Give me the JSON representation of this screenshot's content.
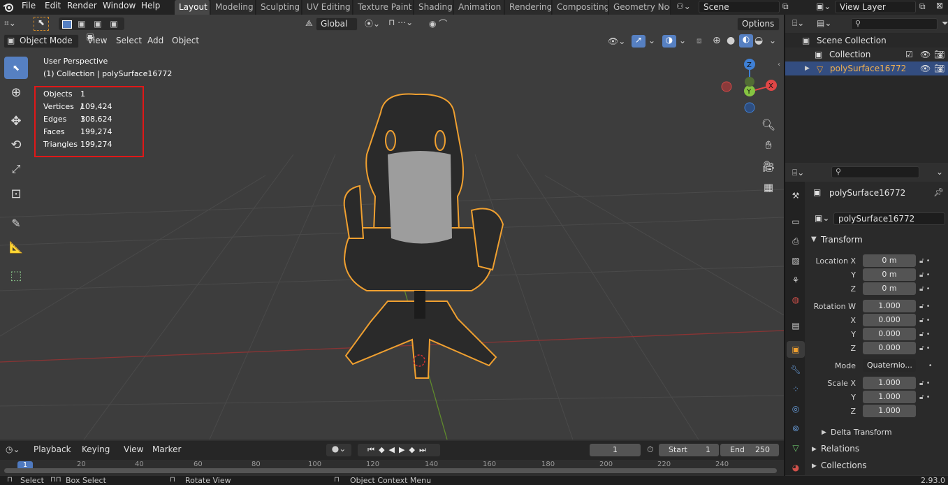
{
  "top_menu": {
    "items": [
      "File",
      "Edit",
      "Render",
      "Window",
      "Help"
    ],
    "workspaces": [
      "Layout",
      "Modeling",
      "Sculpting",
      "UV Editing",
      "Texture Paint",
      "Shading",
      "Animation",
      "Rendering",
      "Compositing",
      "Geometry Nod"
    ],
    "scene_name": "Scene",
    "view_layer_name": "View Layer"
  },
  "viewport_header": {
    "transform_orientation": "Global",
    "options_label": "Options",
    "mode_label": "Object Mode",
    "menus": [
      "View",
      "Select",
      "Add",
      "Object"
    ]
  },
  "viewport": {
    "perspective_label": "User Perspective",
    "collection_label": "(1) Collection | polySurface16772",
    "stats": [
      {
        "label": "Objects",
        "value": "1 / 1"
      },
      {
        "label": "Vertices",
        "value": "109,424"
      },
      {
        "label": "Edges",
        "value": "308,624"
      },
      {
        "label": "Faces",
        "value": "199,274"
      },
      {
        "label": "Triangles",
        "value": "199,274"
      }
    ],
    "gizmo_labels": {
      "z": "Z",
      "y": "Y",
      "x": "X"
    },
    "colors": {
      "selection_outline": "#f0a030",
      "x_axis": "#e04646",
      "y_axis": "#86c442",
      "z_axis": "#3f80d5",
      "stats_highlight_box": "#e01818"
    }
  },
  "outliner": {
    "scene_collection": "Scene Collection",
    "collection": "Collection",
    "object": "polySurface16772"
  },
  "properties": {
    "object_name": "polySurface16772",
    "data_name": "polySurface16772",
    "transform_header": "Transform",
    "location": {
      "label": "Location X",
      "x": "0 m",
      "y": "0 m",
      "z": "0 m"
    },
    "rotation": {
      "label": "Rotation W",
      "w": "1.000",
      "x": "0.000",
      "y": "0.000",
      "z": "0.000"
    },
    "mode": {
      "label": "Mode",
      "value": "Quaternio..."
    },
    "scale": {
      "label": "Scale X",
      "x": "1.000",
      "y": "1.000",
      "z": "1.000"
    },
    "axis_labels": {
      "y": "Y",
      "z": "Z",
      "x": "X"
    },
    "delta_transform": "Delta Transform",
    "relations": "Relations",
    "collections": "Collections"
  },
  "timeline": {
    "menus": [
      "Playback",
      "Keying",
      "View",
      "Marker"
    ],
    "current_frame": "1",
    "start_label": "Start",
    "start_value": "1",
    "end_label": "End",
    "end_value": "250",
    "ruler": [
      "1",
      "20",
      "40",
      "60",
      "80",
      "100",
      "120",
      "140",
      "160",
      "180",
      "200",
      "220",
      "240"
    ]
  },
  "statusbar": {
    "select": "Select",
    "box_select": "Box Select",
    "rotate_view": "Rotate View",
    "context_menu": "Object Context Menu",
    "version": "2.93.0"
  }
}
